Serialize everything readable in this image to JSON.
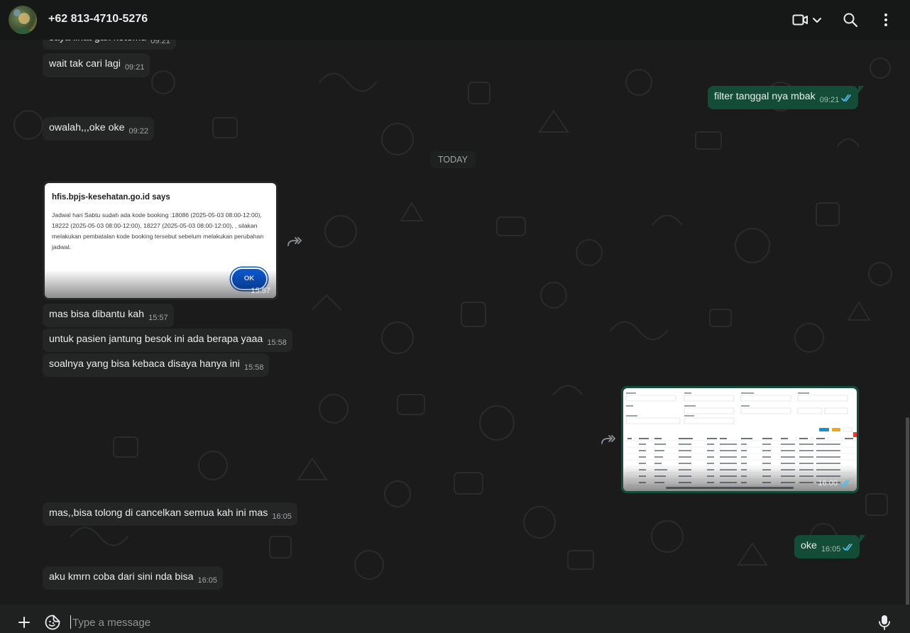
{
  "header": {
    "contact_name": "+62 813-4710-5276"
  },
  "date_divider": "TODAY",
  "messages": {
    "m0": {
      "text": "saya lihat gak ketemu",
      "time": "09:21"
    },
    "m1": {
      "text": "wait tak cari lagi",
      "time": "09:21"
    },
    "m2": {
      "text": "filter tanggal nya mbak",
      "time": "09:21"
    },
    "m3": {
      "text": "owalah,,,oke oke",
      "time": "09:22"
    },
    "m5": {
      "text": "mas bisa dibantu kah",
      "time": "15:57"
    },
    "m6": {
      "text": "untuk pasien jantung besok ini ada berapa yaaa",
      "time": "15:58"
    },
    "m7": {
      "text": "soalnya yang bisa kebaca disaya hanya ini",
      "time": "15:58"
    },
    "m9": {
      "text": "mas,,bisa tolong di cancelkan semua kah ini mas",
      "time": "16:05"
    },
    "m10": {
      "text": "oke",
      "time": "16:05"
    },
    "m11": {
      "text": "aku kmrn coba dari sini nda bisa",
      "time": "16:05"
    }
  },
  "image_dialog": {
    "time": "15:57",
    "title": "hfis.bpjs-kesehatan.go.id says",
    "body": "Jadwal hari Sabtu sudah ada kode booking :18086 (2025-05-03 08:00-12:00), 18222 (2025-05-03 08:00-12:00), 18227 (2025-05-03 08:00-12:00), , silakan melakukan pembatalan kode booking tersebut sebelum melakukan perubahan jadwal.",
    "button": "OK"
  },
  "image_table": {
    "time": "16:00"
  },
  "composer": {
    "placeholder": "Type a message"
  },
  "colors": {
    "incoming_bubble": "#242626",
    "outgoing_bubble": "#144d37",
    "read_tick": "#53bdeb"
  },
  "icons": {
    "video": "video-camera-icon",
    "search": "search-icon",
    "menu": "kebab-menu-icon",
    "attach": "plus-icon",
    "sticker": "sticker-icon",
    "mic": "microphone-icon",
    "forward": "forward-arrow-icon"
  }
}
